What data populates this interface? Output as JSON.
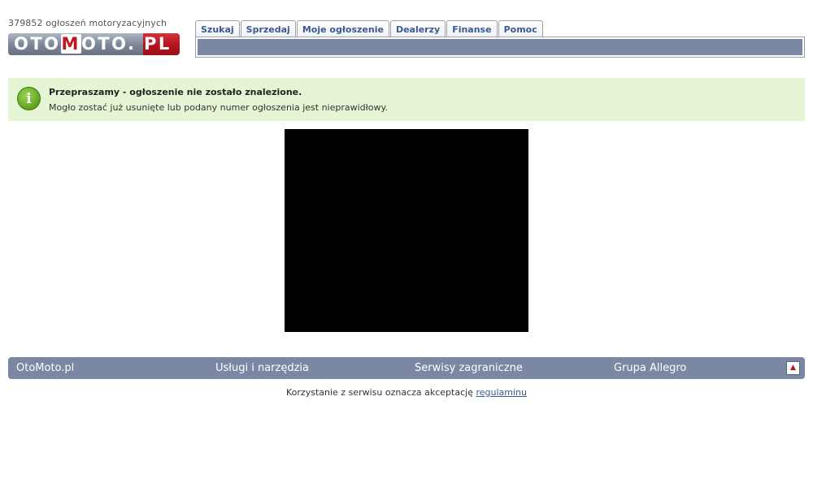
{
  "header": {
    "listing_count": "379852 ogłoszeń motoryzacyjnych",
    "logo_text_main": "OTO",
    "logo_text_m": "M",
    "logo_text_rest": "OTO.",
    "logo_text_pl": "PL"
  },
  "tabs": [
    {
      "label": "Szukaj"
    },
    {
      "label": "Sprzedaj"
    },
    {
      "label": "Moje ogłoszenie"
    },
    {
      "label": "Dealerzy"
    },
    {
      "label": "Finanse"
    },
    {
      "label": "Pomoc"
    }
  ],
  "notice": {
    "title": "Przepraszamy - ogłoszenie nie zostało znalezione.",
    "text": "Mogło zostać już usunięte lub podany numer ogłoszenia jest nieprawidłowy.",
    "icon": "info-icon"
  },
  "footer": {
    "links": [
      {
        "label": "OtoMoto.pl"
      },
      {
        "label": "Usługi i narzędzia"
      },
      {
        "label": "Serwisy zagraniczne"
      },
      {
        "label": "Grupa Allegro"
      }
    ],
    "up_icon": "arrow-up-icon",
    "legal_text": "Korzystanie z serwisu oznacza akceptację",
    "legal_link": "regulaminu"
  },
  "colors": {
    "nav_bar": "#7b87a3",
    "tab_text": "#3b5a8f",
    "notice_bg": "#e6f6d4",
    "logo_red": "#b3131d"
  }
}
